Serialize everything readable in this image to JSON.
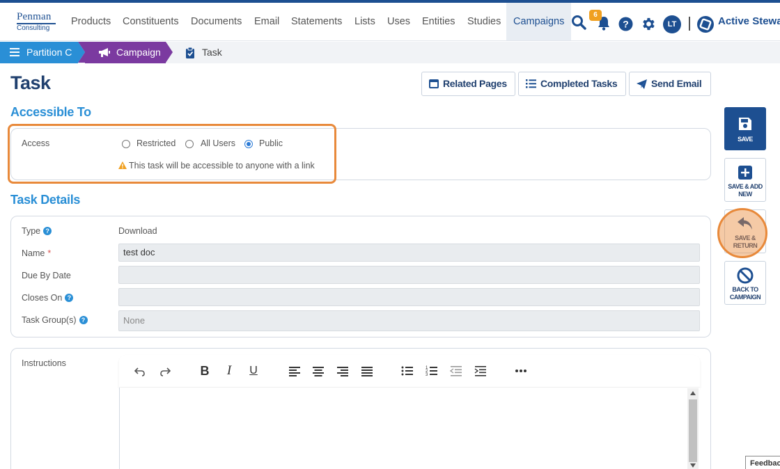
{
  "nav": {
    "logo_line1": "Penman",
    "logo_line2": "Consulting",
    "items": [
      "Products",
      "Constituents",
      "Documents",
      "Email",
      "Statements",
      "Lists",
      "Uses",
      "Entities",
      "Studies",
      "Campaigns"
    ],
    "active_item": "Campaigns",
    "notification_count": "6",
    "user_initials": "LT",
    "org_name": "Active Stewa"
  },
  "breadcrumb": {
    "partition": "Partition C",
    "campaign": "Campaign",
    "current": "Task"
  },
  "page": {
    "title": "Task",
    "buttons": {
      "related_pages": "Related Pages",
      "completed_tasks": "Completed Tasks",
      "send_email": "Send Email"
    }
  },
  "access": {
    "section_title": "Accessible To",
    "label": "Access",
    "options": [
      "Restricted",
      "All Users",
      "Public"
    ],
    "selected": "Public",
    "warning": "This task will be accessible to anyone with a link"
  },
  "details": {
    "section_title": "Task Details",
    "type_label": "Type",
    "type_value": "Download",
    "name_label": "Name",
    "name_value": "test doc",
    "due_label": "Due By Date",
    "due_value": "",
    "closes_label": "Closes On",
    "closes_value": "",
    "groups_label": "Task Group(s)",
    "groups_placeholder": "None"
  },
  "instructions": {
    "label": "Instructions",
    "toolbar_icons": [
      "undo-icon",
      "redo-icon",
      "bold-icon",
      "italic-icon",
      "underline-icon",
      "align-left-icon",
      "align-center-icon",
      "align-right-icon",
      "align-justify-icon",
      "bullet-list-icon",
      "numbered-list-icon",
      "outdent-icon",
      "indent-icon",
      "more-icon"
    ],
    "bold": "B",
    "italic": "I",
    "underline": "U"
  },
  "side_actions": {
    "save": "SAVE",
    "save_add_new": "SAVE & ADD NEW",
    "save_return": "SAVE & RETURN",
    "back_to_campaign": "BACK TO CAMPAIGN"
  },
  "feedback": "Feedbac",
  "colors": {
    "brand": "#1d4f91",
    "accent": "#2a8fd6",
    "campaign_crumb": "#7b3aa0",
    "highlight": "#e8893a"
  }
}
